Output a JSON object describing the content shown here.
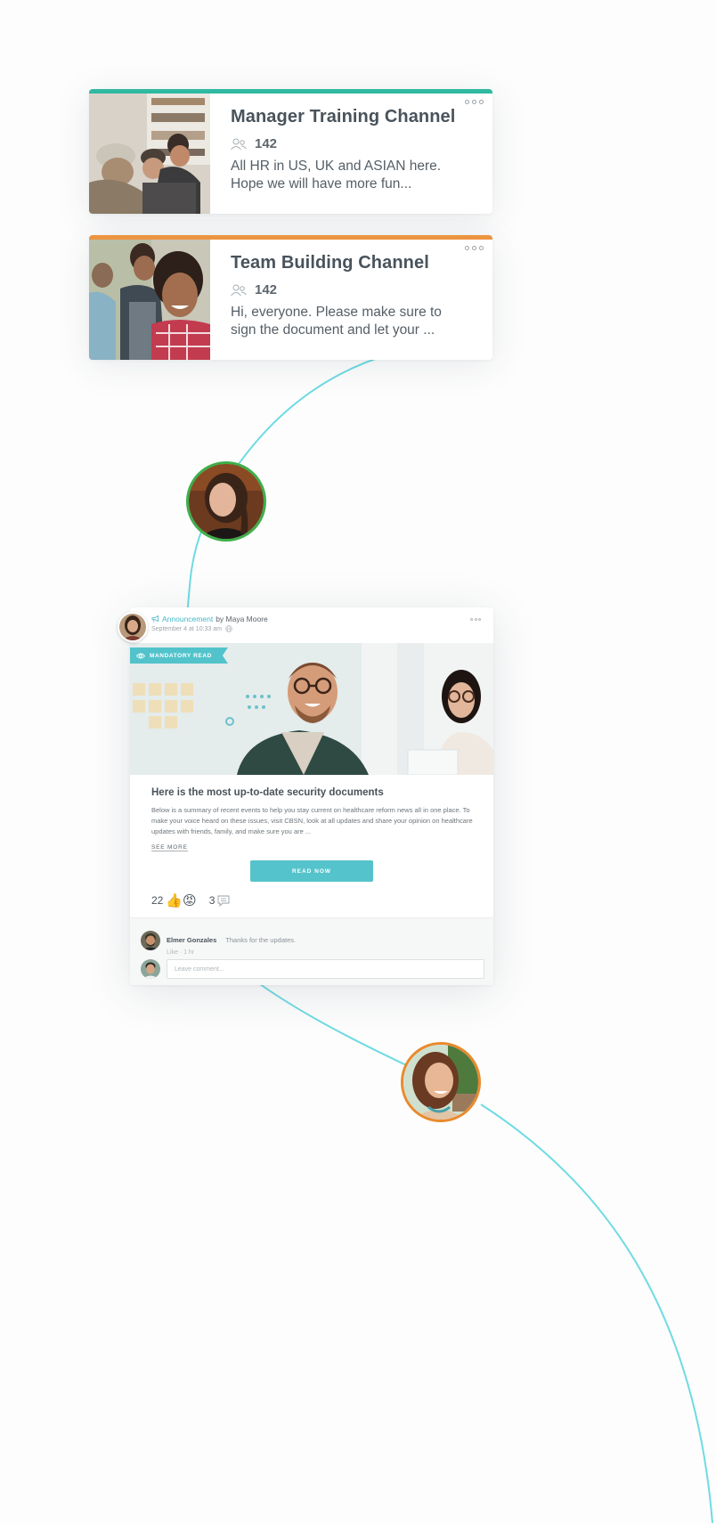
{
  "colors": {
    "teal": "#2fb9a0",
    "orange": "#ec9440",
    "accent": "#52c3cb",
    "connector": "#6fdbe3",
    "green_ring": "#3eae4a",
    "orange_ring": "#e98a2c"
  },
  "channels": [
    {
      "title": "Manager Training Channel",
      "members_icon": "members-icon",
      "member_count": "142",
      "description": "All HR in US, UK and ASIAN here. Hope we will have more fun...",
      "accent": "teal"
    },
    {
      "title": "Team Building Channel",
      "members_icon": "members-icon",
      "member_count": "142",
      "description": "Hi, everyone. Please make sure to sign the document and let your ...",
      "accent": "orange"
    }
  ],
  "post": {
    "type_icon": "megaphone-icon",
    "type": "Announcement",
    "by": "by Maya Moore",
    "timestamp": "September 4 at 10:33 am",
    "privacy_icon": "globe-icon",
    "badge_icon": "eye-icon",
    "badge": "MANDATORY READ",
    "title": "Here is the most up-to-date security documents",
    "text": "Below is a summary of recent events to help you stay current on healthcare reform news all in one place. To make your voice heard on these issues, visit CBSN, look at all updates and share your opinion on healthcare updates with friends, family, and make sure you are ...",
    "see_more": "SEE MORE",
    "read_now": "READ NOW",
    "reaction_count": "22",
    "reaction_emojis": "👍😡",
    "comment_count": "3",
    "comments": [
      {
        "author": "Elmer Gonzales",
        "text": "Thanks for the updates.",
        "like": "Like",
        "time": "1 hr"
      }
    ],
    "comment_placeholder": "Leave comment..."
  }
}
